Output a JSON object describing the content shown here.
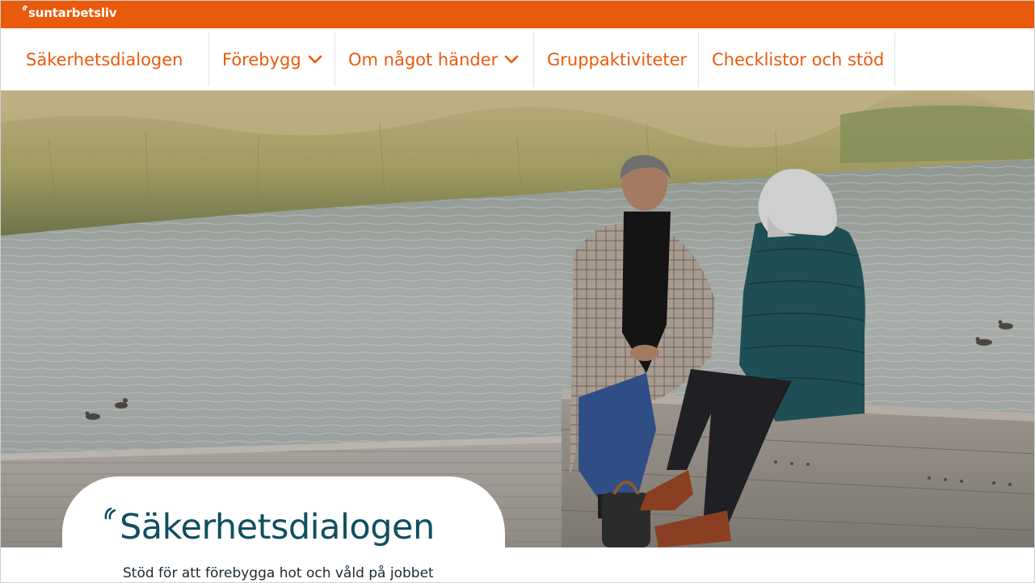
{
  "brand": {
    "name": "suntarbetsliv",
    "color": "#e95a0c"
  },
  "nav": {
    "items": [
      {
        "label": "Säkerhetsdialogen",
        "has_dropdown": false
      },
      {
        "label": "Förebygg",
        "has_dropdown": true
      },
      {
        "label": "Om något händer",
        "has_dropdown": true
      },
      {
        "label": "Gruppaktiviteter",
        "has_dropdown": false
      },
      {
        "label": "Checklistor och stöd",
        "has_dropdown": false
      }
    ]
  },
  "hero": {
    "image": "photo-two-women-talking-by-water",
    "title": "Säkerhetsdialogen",
    "subtitle": "Stöd för att förebygga hot och våld på jobbet",
    "title_color": "#0f4f5f"
  },
  "icons": {
    "dropdown": "chevron-down-icon",
    "quote": "quote-mark-icon"
  }
}
